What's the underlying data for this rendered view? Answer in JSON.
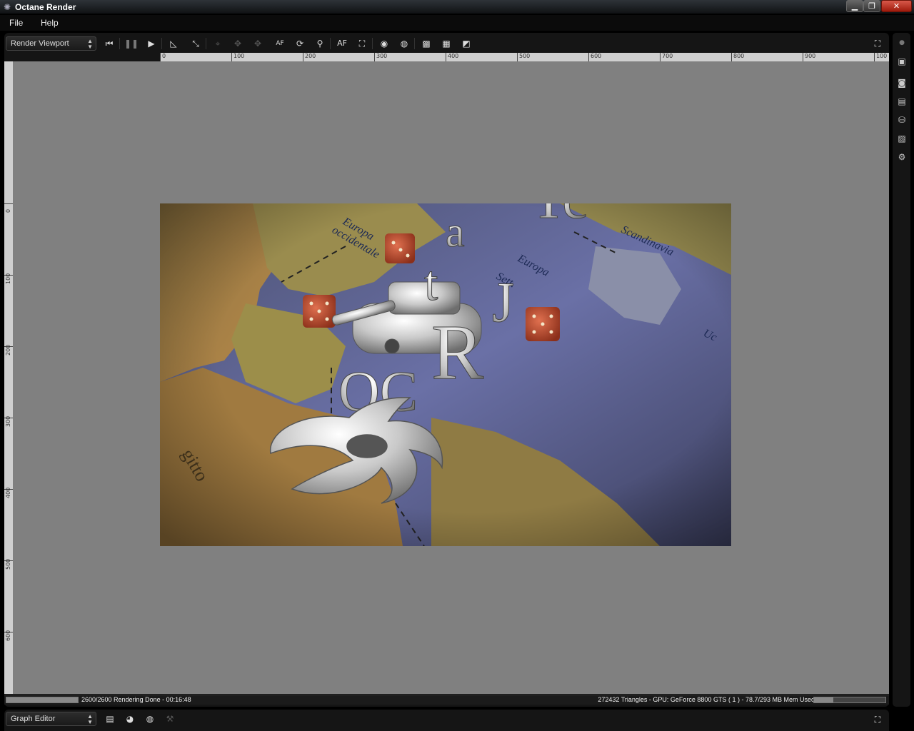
{
  "window": {
    "title": "Octane Render",
    "min_glyph": "▁",
    "max_glyph": "❐",
    "close_glyph": "✕"
  },
  "menu": [
    "File",
    "Help"
  ],
  "viewport": {
    "selector_value": "Render Viewport",
    "ruler_x_ticks": [
      "0",
      "100",
      "200",
      "300",
      "400",
      "500",
      "600",
      "700",
      "800",
      "900",
      "100"
    ],
    "ruler_y_ticks": [
      "0",
      "100",
      "200",
      "300",
      "400",
      "500",
      "600"
    ],
    "toolbar_icons": [
      "restart-icon",
      "pause-icon",
      "play-icon",
      "region-icon",
      "zoom-fit-icon",
      "pick-focus-icon",
      "pick-material-icon",
      "pick-object-icon",
      "autofocus-icon",
      "reset-camera-icon",
      "pick-white-point-icon",
      "af-icon",
      "texture-icon",
      "sphere-icon",
      "sphere-flat-icon",
      "checker-fine-icon",
      "checker-icon",
      "checker-large-icon"
    ],
    "scene_labels": [
      "Europa\noccidentale",
      "Scandinavia",
      "Europa\nSettentrionale",
      "gitto",
      "Uc"
    ]
  },
  "status": {
    "left_text": "2600/2600 Rendering Done - 00:16:48",
    "progress": 1.0,
    "right_text": "272432 Triangles - GPU: GeForce 8800 GTS ( 1 ) - 78.7/293 MB Mem Used",
    "mem_used_fraction": 0.27
  },
  "sidebar_icons": [
    "dot-icon",
    "image-icon",
    "camera-icon",
    "layers-icon",
    "database-icon",
    "picture-icon",
    "settings-icon"
  ],
  "graph_editor": {
    "selector_value": "Graph Editor",
    "icons": [
      "save-node-icon",
      "material-icon",
      "sphere-node-icon",
      "disabled-node-icon"
    ]
  },
  "colors": {
    "canvas_bg": "#808080",
    "sea": "#5c6294",
    "land_olive": "#9a8a4a",
    "land_brown": "#8a6a3a",
    "dice_red": "#c0492b"
  }
}
